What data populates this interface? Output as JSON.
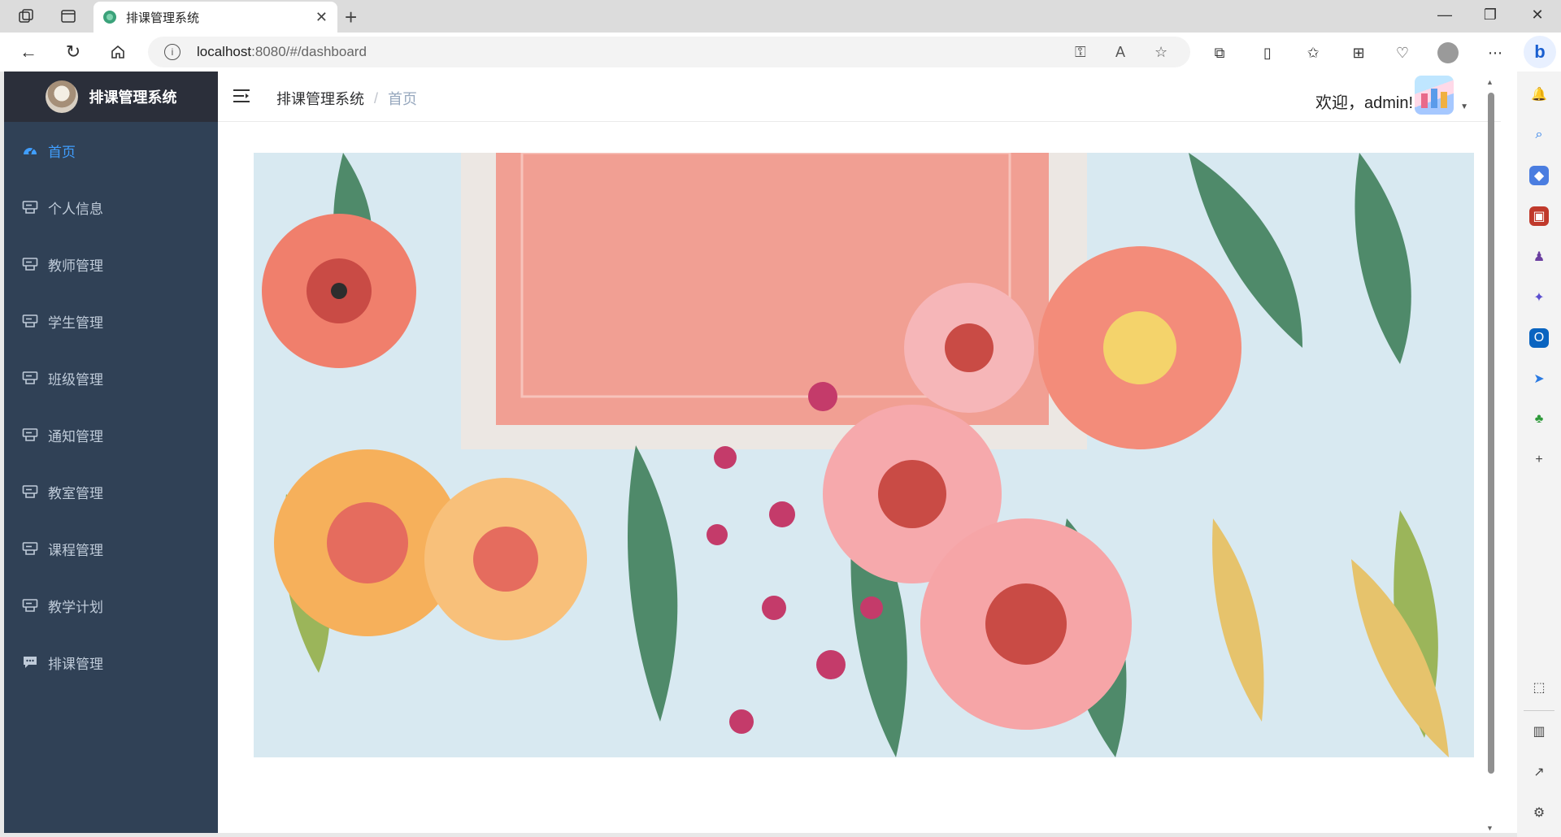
{
  "browser": {
    "tab_title": "排课管理系统",
    "url_host": "localhost",
    "url_rest": ":8080/#/dashboard"
  },
  "sidebar": {
    "logo_title": "排课管理系统",
    "items": [
      {
        "label": "首页",
        "icon": "dashboard-icon",
        "active": true
      },
      {
        "label": "个人信息",
        "icon": "form-icon"
      },
      {
        "label": "教师管理",
        "icon": "form-icon"
      },
      {
        "label": "学生管理",
        "icon": "form-icon"
      },
      {
        "label": "班级管理",
        "icon": "form-icon"
      },
      {
        "label": "通知管理",
        "icon": "form-icon"
      },
      {
        "label": "教室管理",
        "icon": "form-icon"
      },
      {
        "label": "课程管理",
        "icon": "form-icon"
      },
      {
        "label": "教学计划",
        "icon": "form-icon"
      },
      {
        "label": "排课管理",
        "icon": "message-icon"
      }
    ]
  },
  "navbar": {
    "breadcrumb": [
      "排课管理系统",
      "首页"
    ],
    "welcome": "欢迎，admin!"
  },
  "colors": {
    "sidebar_bg": "#304156",
    "logo_bg": "#2b2f3a",
    "active": "#409eff",
    "menu_text": "#bfcbd9"
  }
}
